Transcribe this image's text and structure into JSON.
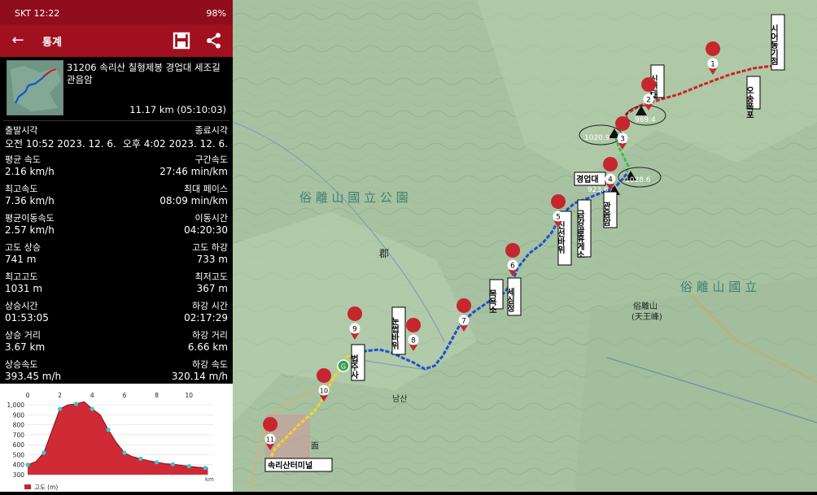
{
  "status_bar": {
    "carrier_time": "SKT 12:22",
    "battery": "98%"
  },
  "app_bar": {
    "title": "통계",
    "back_icon": "arrow-left-icon",
    "save_icon": "save-icon",
    "share_icon": "share-icon"
  },
  "route": {
    "name": "31206 속리산 칠형제봉 경업대 세조길 관음암",
    "distance_time": "11.17 km (05:10:03)"
  },
  "stats": [
    {
      "left_label": "출발시각",
      "left_value": "오전 10:52 2023. 12. 6.",
      "right_label": "종료시각",
      "right_value": "오후 4:02 2023. 12. 6."
    },
    {
      "left_label": "평균 속도",
      "left_value": "2.16 km/h",
      "right_label": "구간속도",
      "right_value": "27:46 min/km"
    },
    {
      "left_label": "최고속도",
      "left_value": "7.36 km/h",
      "right_label": "최대 페이스",
      "right_value": "08:09 min/km"
    },
    {
      "left_label": "평균이동속도",
      "left_value": "2.57 km/h",
      "right_label": "이동시간",
      "right_value": "04:20:30"
    },
    {
      "left_label": "고도 상승",
      "left_value": "741 m",
      "right_label": "고도 하강",
      "right_value": "733 m"
    },
    {
      "left_label": "최고고도",
      "left_value": "1031 m",
      "right_label": "최저고도",
      "right_value": "367 m"
    },
    {
      "left_label": "상승시간",
      "left_value": "01:53:05",
      "right_label": "하강 시간",
      "right_value": "02:17:29"
    },
    {
      "left_label": "상승 거리",
      "left_value": "3.67 km",
      "right_label": "하강 거리",
      "right_value": "6.66 km"
    },
    {
      "left_label": "상승속도",
      "left_value": "393.45 m/h",
      "right_label": "하강 속도",
      "right_value": "320.14 m/h"
    }
  ],
  "chart_data": {
    "type": "area",
    "x": [
      0,
      0.5,
      1,
      1.5,
      2,
      2.5,
      3,
      3.5,
      4,
      4.5,
      5,
      5.5,
      6,
      6.5,
      7,
      7.5,
      8,
      8.5,
      9,
      9.5,
      10,
      10.5,
      11,
      11.17
    ],
    "values": [
      400,
      430,
      520,
      740,
      960,
      1000,
      1010,
      1031,
      960,
      900,
      750,
      620,
      520,
      480,
      460,
      440,
      425,
      410,
      405,
      395,
      385,
      375,
      368,
      370
    ],
    "xticks": [
      "0",
      "2",
      "4",
      "6",
      "8",
      "10"
    ],
    "yticks": [
      "300",
      "400",
      "500",
      "600",
      "700",
      "800",
      "900",
      "1,000"
    ],
    "ylim": [
      300,
      1050
    ],
    "xlim": [
      0,
      11.5
    ],
    "legend": "고도 (m)",
    "x_unit_label": "km"
  },
  "map": {
    "labels": {
      "park1": "俗 離 山 國 立 公 園",
      "park2": "俗 離 山 國 立",
      "peak": "俗離山",
      "peak2": "(天王峰)",
      "district": "郡",
      "namsan": "남산",
      "myeon": "面"
    },
    "waypoints": [
      {
        "num": "1",
        "label": "시어동기점"
      },
      {
        "num": "2",
        "label": "칠형제봉"
      },
      {
        "num": "3",
        "label": "1020.9"
      },
      {
        "num": "4",
        "label": "1028.6"
      },
      {
        "num": "5",
        "label": "금강골휴게소"
      },
      {
        "num": "6",
        "label": "세심정"
      },
      {
        "num": "7",
        "label": ""
      },
      {
        "num": "8",
        "label": "눈썹바위"
      },
      {
        "num": "9",
        "label": "법주사"
      },
      {
        "num": "10",
        "label": ""
      },
      {
        "num": "11",
        "label": "속리산터미널"
      }
    ],
    "callouts": {
      "c1": "오송폭포",
      "c2": "신선대",
      "c3": "경업대",
      "c4": "관음암",
      "c5": "923.6",
      "c6": "969.4",
      "c7": "목욕소",
      "c8": "신선바위"
    }
  },
  "colors": {
    "status_bg": "#8f0d1c",
    "appbar_bg": "#a1101f",
    "track_red": "#d0202a",
    "track_blue": "#1f4fd0",
    "track_green": "#3bbf4c",
    "track_yellow": "#f2d624",
    "chart_fill": "#cc1f2b",
    "chart_marker": "#36c8d6"
  }
}
